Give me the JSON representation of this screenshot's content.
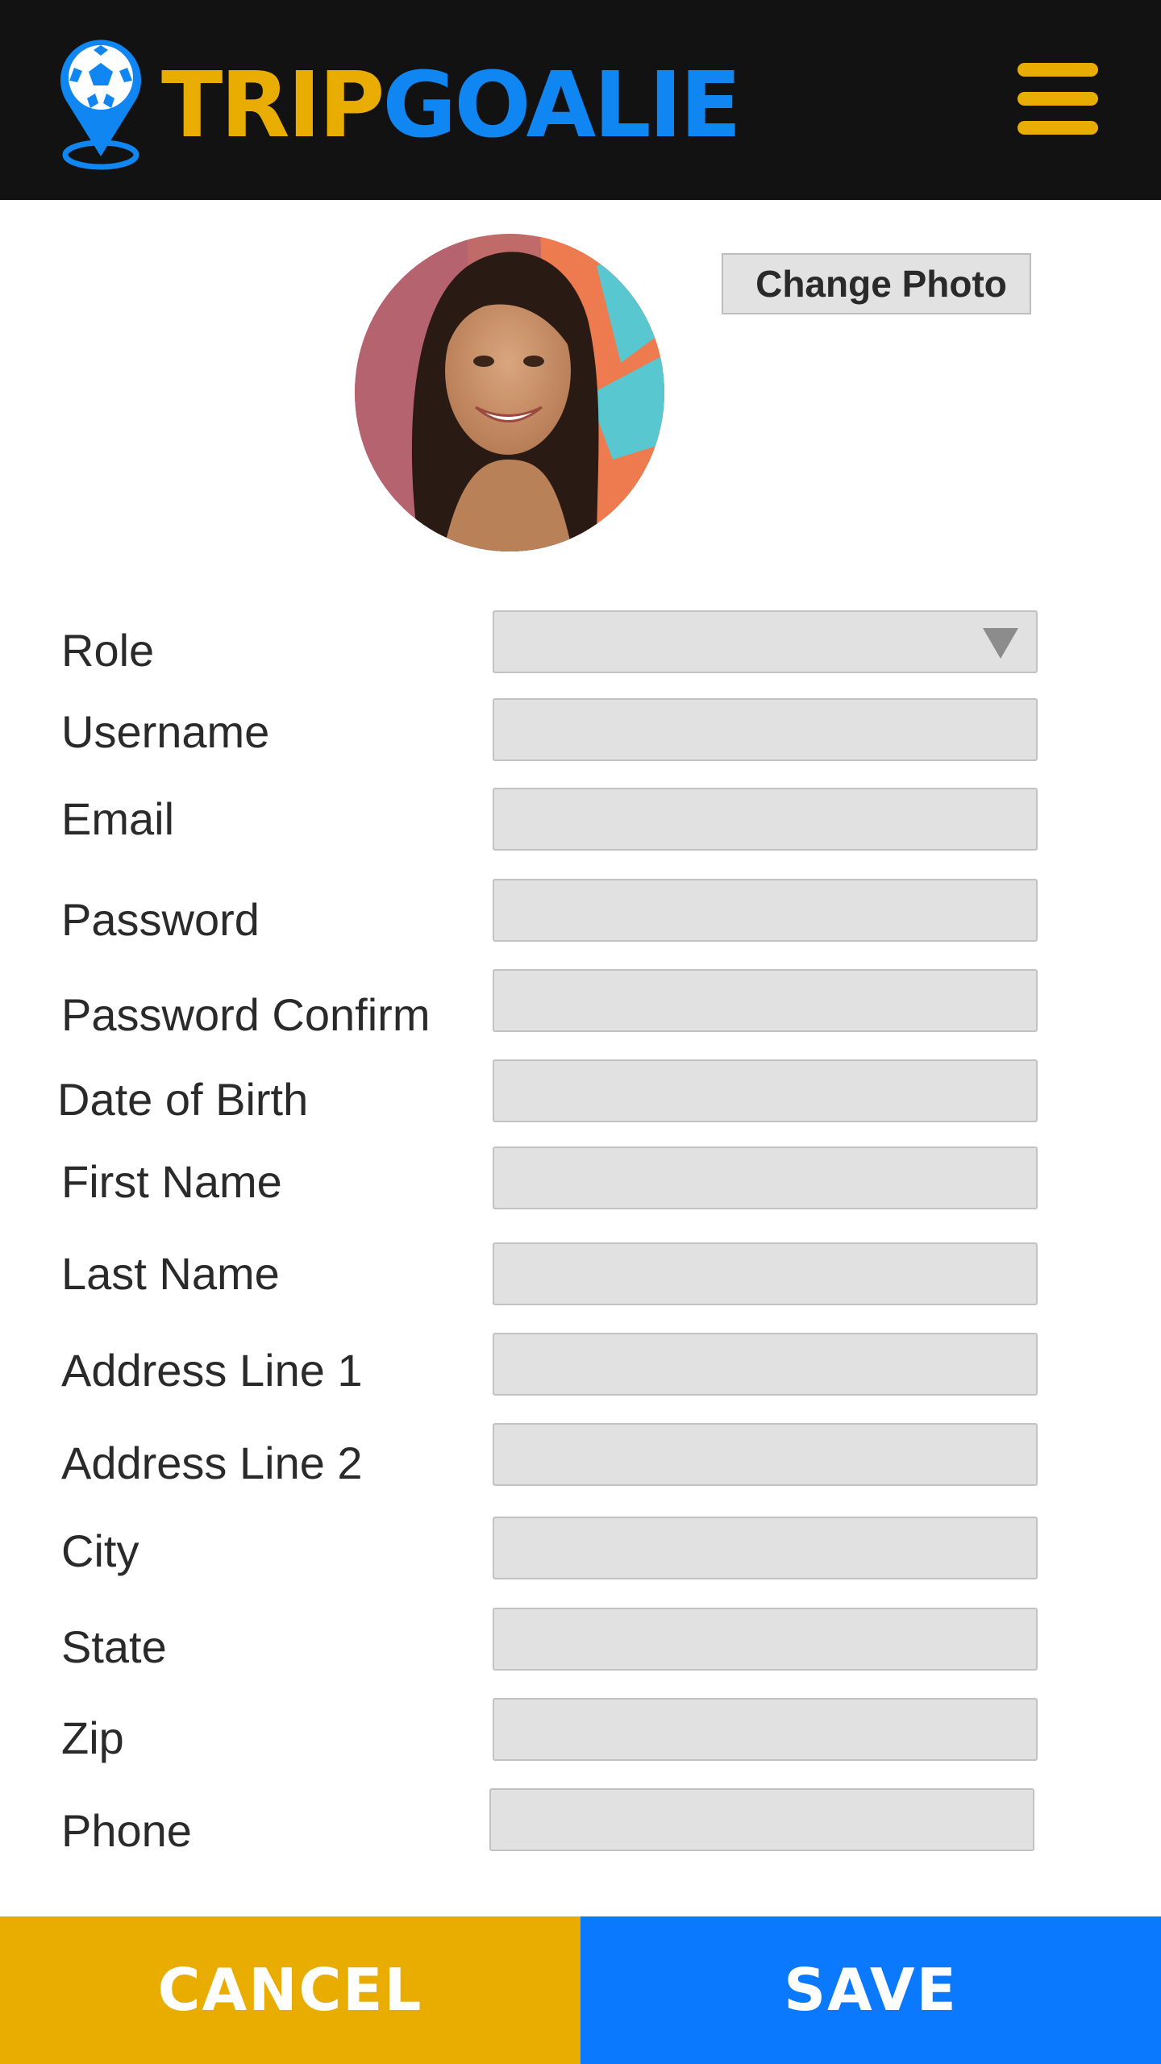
{
  "app": {
    "logo_part1": "TRIP",
    "logo_part2": "GOALIE",
    "brand_colors": {
      "yellow": "#e8ad00",
      "blue": "#0f86f2",
      "header_bg": "#121212"
    },
    "menu_icon": "hamburger-menu-icon"
  },
  "profile": {
    "avatar_icon": "user-photo",
    "change_photo_label": "Change Photo"
  },
  "form": {
    "fields": [
      {
        "label": "Role",
        "value": "",
        "type": "select"
      },
      {
        "label": "Username",
        "value": ""
      },
      {
        "label": "Email",
        "value": ""
      },
      {
        "label": "Password",
        "value": ""
      },
      {
        "label": "Password Confirm",
        "value": ""
      },
      {
        "label": "Date of Birth",
        "value": ""
      },
      {
        "label": "First Name",
        "value": ""
      },
      {
        "label": "Last Name",
        "value": ""
      },
      {
        "label": "Address Line 1",
        "value": ""
      },
      {
        "label": "Address Line 2",
        "value": ""
      },
      {
        "label": "City",
        "value": ""
      },
      {
        "label": "State",
        "value": ""
      },
      {
        "label": "Zip",
        "value": ""
      },
      {
        "label": "Phone",
        "value": ""
      }
    ]
  },
  "footer": {
    "cancel_label": "CANCEL",
    "save_label": "SAVE",
    "cancel_color": "#e8ad00",
    "save_color": "#0a79fe"
  }
}
